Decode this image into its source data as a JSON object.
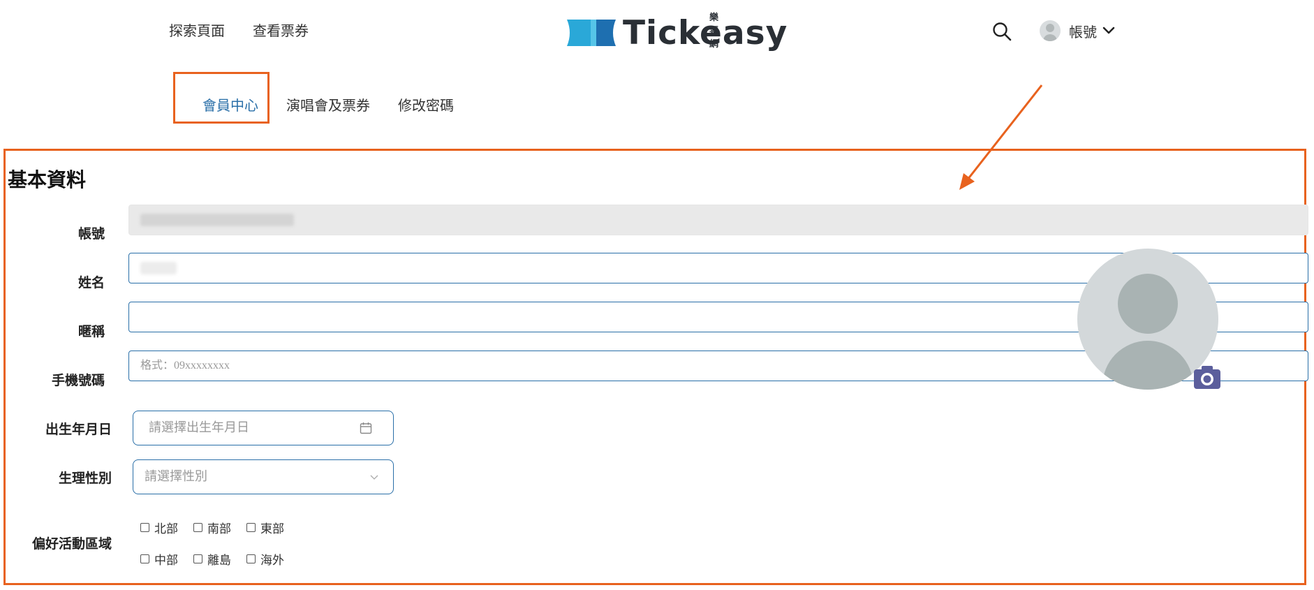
{
  "header": {
    "nav_links": [
      "探索頁面",
      "查看票券"
    ],
    "logo": {
      "brand": "Tickeasy",
      "subtitle": "樂票網"
    },
    "account_label": "帳號",
    "icons": {
      "search": "search-icon",
      "account": "avatar-icon",
      "dropdown": "chevron-down-icon"
    }
  },
  "tabs": [
    {
      "label": "會員中心",
      "active": true
    },
    {
      "label": "演唱會及票券",
      "active": false
    },
    {
      "label": "修改密碼",
      "active": false
    }
  ],
  "section": {
    "title": "基本資料",
    "fields": {
      "account": {
        "label": "帳號",
        "value": ""
      },
      "name": {
        "label": "姓名",
        "value": ""
      },
      "nickname": {
        "label": "暱稱",
        "value": ""
      },
      "phone": {
        "label": "手機號碼",
        "placeholder": "格式：09xxxxxxxx"
      },
      "birthday": {
        "label": "出生年月日",
        "placeholder": "請選擇出生年月日"
      },
      "gender": {
        "label": "生理性別",
        "placeholder": "請選擇性別"
      }
    },
    "regions": {
      "label": "偏好活動區域",
      "options": [
        "北部",
        "南部",
        "東部",
        "中部",
        "離島",
        "海外"
      ]
    }
  },
  "colors": {
    "accent": "#2a6fa8",
    "annotation": "#e8621e",
    "logo_blue": "#2aa8d8",
    "camera": "#5b5e9c"
  }
}
